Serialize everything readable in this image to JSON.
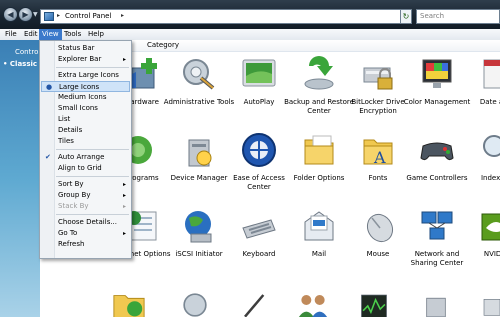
{
  "address": {
    "crumb": "Control Panel",
    "separator_left": "▸",
    "separator_right": "▸"
  },
  "search": {
    "placeholder": "Search"
  },
  "menubar": {
    "file": "File",
    "edit": "Edit",
    "view": "View",
    "tools": "Tools",
    "help": "Help"
  },
  "left_pane": {
    "title": "Control",
    "classic": "Classic Vi"
  },
  "columns": {
    "category": "Category"
  },
  "view_menu": {
    "items": [
      {
        "label": "Status Bar"
      },
      {
        "label": "Explorer Bar",
        "arrow": "▸"
      },
      {
        "label": "Extra Large Icons"
      },
      {
        "label": "Large Icons",
        "mark": "●"
      },
      {
        "label": "Medium Icons"
      },
      {
        "label": "Small Icons"
      },
      {
        "label": "List"
      },
      {
        "label": "Details"
      },
      {
        "label": "Tiles"
      },
      {
        "label": "Auto Arrange",
        "mark": "✔"
      },
      {
        "label": "Align to Grid"
      },
      {
        "label": "Sort By",
        "arrow": "▸"
      },
      {
        "label": "Group By",
        "arrow": "▸"
      },
      {
        "label": "Stack By",
        "arrow": "▸"
      },
      {
        "label": "Choose Details..."
      },
      {
        "label": "Go To",
        "arrow": "▸"
      },
      {
        "label": "Refresh"
      }
    ]
  },
  "items": [
    {
      "label": "Hardware",
      "icon": "add-hardware-icon"
    },
    {
      "label": "Administrative Tools",
      "icon": "administrative-tools-icon"
    },
    {
      "label": "AutoPlay",
      "icon": "autoplay-icon"
    },
    {
      "label": "Backup and Restore Center",
      "icon": "backup-icon"
    },
    {
      "label": "BitLocker Drive Encryption",
      "icon": "bitlocker-icon"
    },
    {
      "label": "Color Management",
      "icon": "color-management-icon"
    },
    {
      "label": "Date and",
      "icon": "date-time-icon"
    },
    {
      "label": "Programs",
      "icon": "default-programs-icon"
    },
    {
      "label": "Device Manager",
      "icon": "device-manager-icon"
    },
    {
      "label": "Ease of Access Center",
      "icon": "ease-of-access-icon"
    },
    {
      "label": "Folder Options",
      "icon": "folder-options-icon"
    },
    {
      "label": "Fonts",
      "icon": "fonts-icon"
    },
    {
      "label": "Game Controllers",
      "icon": "game-controllers-icon"
    },
    {
      "label": "Indexing",
      "icon": "indexing-icon"
    },
    {
      "label": "Internet Options",
      "icon": "internet-options-icon"
    },
    {
      "label": "iSCSI Initiator",
      "icon": "iscsi-icon"
    },
    {
      "label": "Keyboard",
      "icon": "keyboard-icon"
    },
    {
      "label": "Mail",
      "icon": "mail-icon"
    },
    {
      "label": "Mouse",
      "icon": "mouse-icon"
    },
    {
      "label": "Network and Sharing Center",
      "icon": "network-icon"
    },
    {
      "label": "NVIDIA",
      "icon": "nvidia-icon"
    }
  ]
}
